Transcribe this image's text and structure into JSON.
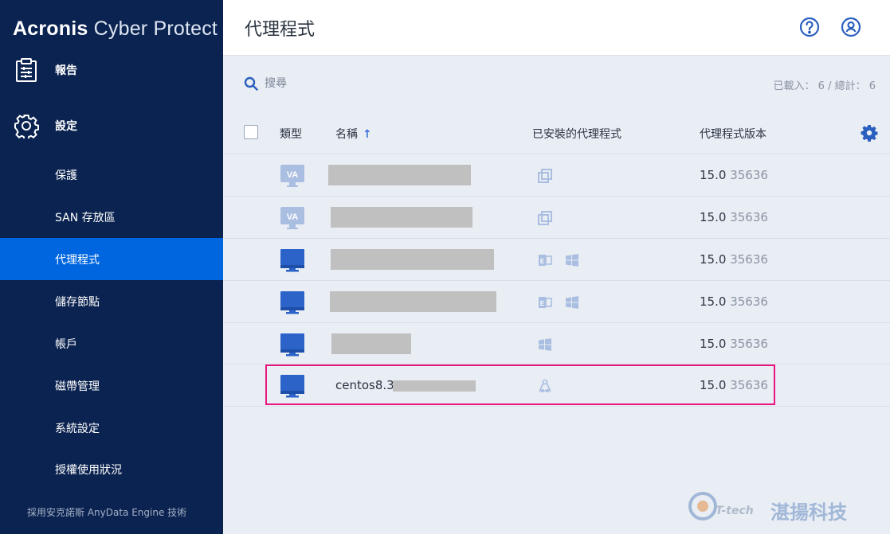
{
  "sidebar": {
    "brand": "Acronis",
    "product": "Cyber Protect",
    "top_items": [
      {
        "label": "報告"
      },
      {
        "label": "設定"
      }
    ],
    "sub_items": [
      {
        "label": "保護"
      },
      {
        "label": "SAN 存放區"
      },
      {
        "label": "代理程式"
      },
      {
        "label": "儲存節點"
      },
      {
        "label": "帳戶"
      },
      {
        "label": "磁帶管理"
      },
      {
        "label": "系統設定"
      },
      {
        "label": "授權使用狀況"
      }
    ],
    "active_item": "代理程式",
    "footer": "採用安克諾斯 AnyData Engine 技術"
  },
  "header": {
    "title": "代理程式"
  },
  "search": {
    "placeholder": "搜尋"
  },
  "counts": "已載入： 6 / 總計： 6",
  "table": {
    "columns": {
      "type": "類型",
      "name": "名稱",
      "installed": "已安裝的代理程式",
      "version": "代理程式版本"
    },
    "rows": [
      {
        "type_icon": "va-icon",
        "name": "",
        "installed": [
          "virtual-appliance-icon"
        ],
        "version_major": "15.0",
        "version_build": "35636"
      },
      {
        "type_icon": "va-icon",
        "name": "",
        "installed": [
          "virtual-appliance-icon"
        ],
        "version_major": "15.0",
        "version_build": "35636"
      },
      {
        "type_icon": "monitor-icon",
        "name": "",
        "installed": [
          "exchange-icon",
          "windows-icon"
        ],
        "version_major": "15.0",
        "version_build": "35636"
      },
      {
        "type_icon": "monitor-icon",
        "name": "",
        "installed": [
          "exchange-icon",
          "windows-icon"
        ],
        "version_major": "15.0",
        "version_build": "35636"
      },
      {
        "type_icon": "monitor-icon",
        "name": "",
        "installed": [
          "windows-icon"
        ],
        "version_major": "15.0",
        "version_build": "35636"
      },
      {
        "type_icon": "monitor-icon",
        "name": "centos8.3.",
        "installed": [
          "linux-icon"
        ],
        "version_major": "15.0",
        "version_build": "35636"
      }
    ]
  },
  "watermark": {
    "tech": "T-tech",
    "company": "湛揚科技"
  },
  "colors": {
    "sidebar_bg": "#0b2350",
    "active_bg": "#0066e0",
    "accent": "#3b6fd6",
    "highlight": "#e8157f"
  }
}
